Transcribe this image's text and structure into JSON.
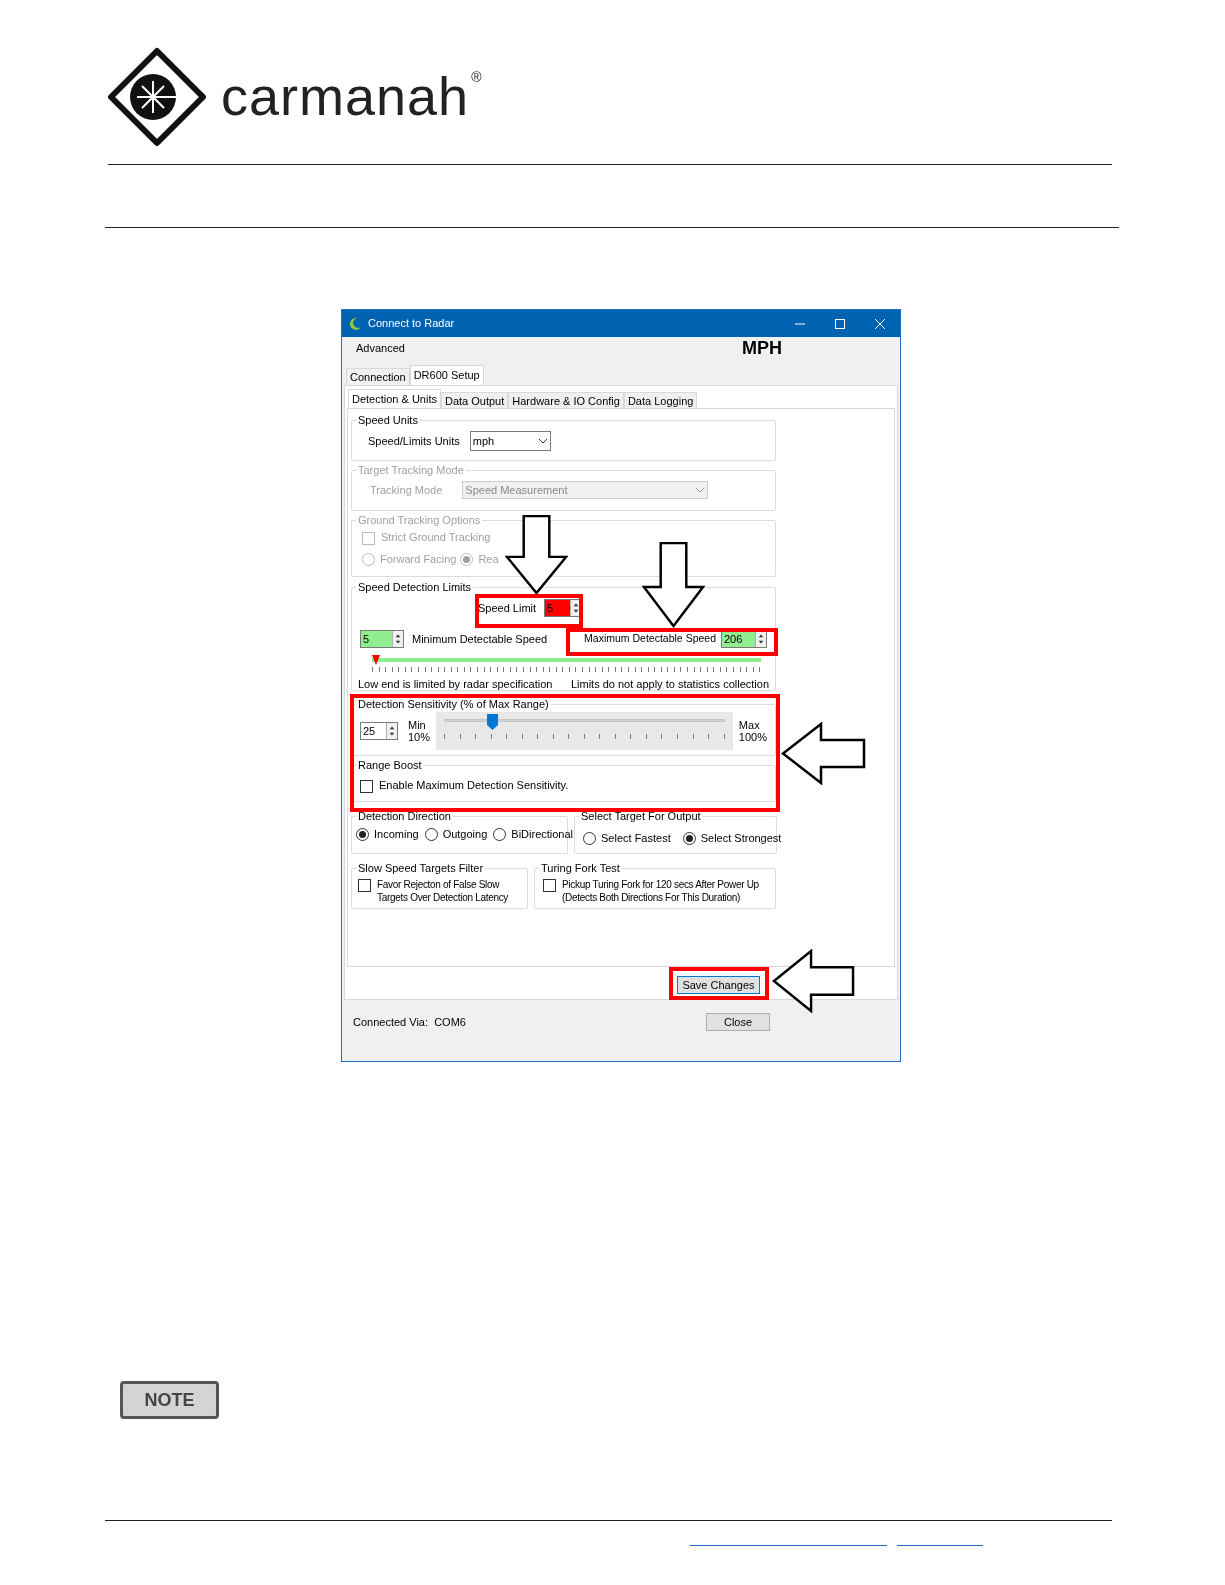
{
  "logo": {
    "name": "carmanah",
    "mark": "®"
  },
  "window": {
    "title": "Connect to Radar",
    "menu": [
      "Advanced"
    ],
    "units_heading": "MPH",
    "outer_tabs": [
      {
        "label": "Connection",
        "selected": false
      },
      {
        "label": "DR600 Setup",
        "selected": true
      }
    ],
    "inner_tabs": [
      {
        "label": "Detection & Units",
        "selected": true
      },
      {
        "label": "Data Output",
        "selected": false
      },
      {
        "label": "Hardware & IO Config",
        "selected": false
      },
      {
        "label": "Data Logging",
        "selected": false
      }
    ],
    "speed_units": {
      "title": "Speed Units",
      "label": "Speed/Limits Units",
      "value": "mph"
    },
    "target_tracking": {
      "title": "Target Tracking Mode",
      "disabled": true,
      "label": "Tracking Mode",
      "value": "Speed Measurement"
    },
    "ground_tracking": {
      "title": "Ground Tracking Options",
      "disabled": true,
      "checkbox": {
        "label": "Strict Ground Tracking",
        "checked": false
      },
      "radios": [
        {
          "label": "Forward Facing",
          "selected": false
        },
        {
          "label": "Rea",
          "selected": true
        }
      ]
    },
    "speed_limits": {
      "title": "Speed Detection Limits",
      "speed_limit": {
        "label": "Speed Limit",
        "value": "5",
        "color": "#ff0000"
      },
      "minimum": {
        "label": "Minimum Detectable Speed",
        "value": "5",
        "color": "#90ee90"
      },
      "maximum": {
        "label": "Maximum Detectable Speed",
        "value": "206",
        "color": "#90ee90"
      },
      "range": {
        "level": 1
      },
      "note_left": "Low end is limited by radar specification",
      "note_right": "Limits do not apply to statistics collection"
    },
    "sensitivity": {
      "title": "Detection Sensitivity (% of Max Range)",
      "field": {
        "value": "25"
      },
      "min_label": "Min",
      "min_value": "10%",
      "max_label": "Max",
      "max_value": "100%",
      "level": 0.17
    },
    "range_boost": {
      "title": "Range Boost",
      "checkbox": {
        "label": "Enable Maximum Detection Sensitivity.",
        "checked": false
      }
    },
    "detection_direction": {
      "title": "Detection Direction",
      "options": [
        {
          "label": "Incoming",
          "selected": true
        },
        {
          "label": "Outgoing",
          "selected": false
        },
        {
          "label": "BiDirectional",
          "selected": false
        }
      ]
    },
    "select_target": {
      "title": "Select Target For Output",
      "options": [
        {
          "label": "Select Fastest",
          "selected": false
        },
        {
          "label": "Select Strongest",
          "selected": true
        }
      ]
    },
    "slow_filter": {
      "title": "Slow Speed Targets Filter",
      "checkbox": {
        "label": "Favor Rejecton of False Slow Targets Over Detection Latency",
        "checked": false
      }
    },
    "tuning_fork": {
      "title": "Turing Fork Test",
      "checkbox": {
        "label": "Pickup Turing Fork for 120 secs After Power Up (Detects Both Directions For This Duration)",
        "checked": false
      }
    },
    "save_button": "Save Changes",
    "connection": "Connected Via:  COM6",
    "close_button": "Close"
  },
  "note_badge": "NOTE"
}
